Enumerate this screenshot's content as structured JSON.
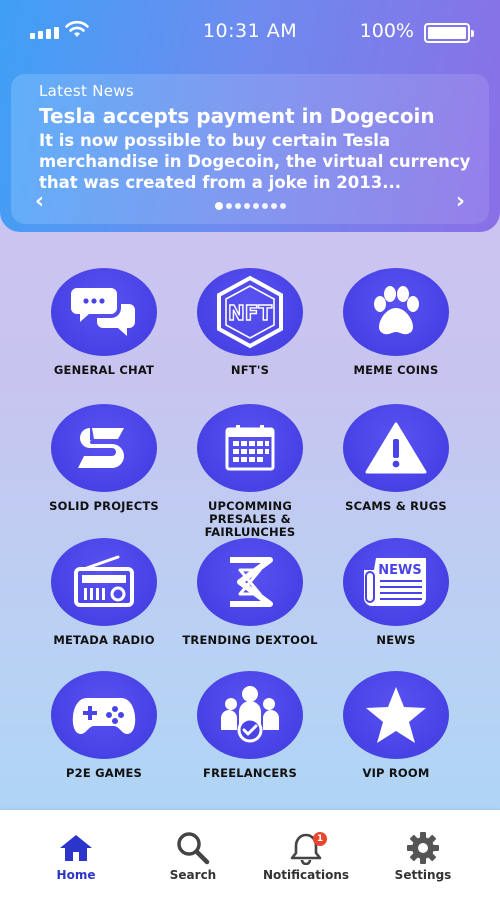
{
  "status_bar": {
    "time": "10:31 AM",
    "battery_percent": "100%",
    "battery_level": 1.0,
    "signal_icon": "signal-bars-icon",
    "wifi_icon": "wifi-icon"
  },
  "news": {
    "label": "Latest News",
    "title": "Tesla accepts payment in Dogecoin",
    "body": "It is now possible to buy certain Tesla merchandise in Dogecoin, the virtual currency that was created from a joke in 2013...",
    "prev_icon": "chevron-left-icon",
    "next_icon": "chevron-right-icon",
    "page_count": 8,
    "active_page": 1
  },
  "tiles": [
    {
      "label": "GENERAL CHAT",
      "icon": "chat-bubbles-icon"
    },
    {
      "label": "NFT'S",
      "icon": "nft-hexagon-icon"
    },
    {
      "label": "MEME COINS",
      "icon": "paw-icon"
    },
    {
      "label": "SOLID PROJECTS",
      "icon": "s-logo-icon"
    },
    {
      "label": "UPCOMMING PRESALES & FAIRLUNCHES",
      "icon": "calendar-icon"
    },
    {
      "label": "SCAMS & RUGS",
      "icon": "warning-icon"
    },
    {
      "label": "METADA RADIO",
      "icon": "radio-icon"
    },
    {
      "label": "TRENDING DEXTOOL",
      "icon": "dextool-icon"
    },
    {
      "label": "NEWS",
      "icon": "newspaper-icon"
    },
    {
      "label": "P2E GAMES",
      "icon": "gamepad-icon"
    },
    {
      "label": "FREELANCERS",
      "icon": "freelancers-icon"
    },
    {
      "label": "VIP ROOM",
      "icon": "star-icon"
    }
  ],
  "tabbar": {
    "tabs": [
      {
        "label": "Home",
        "icon": "home-icon",
        "active": true
      },
      {
        "label": "Search",
        "icon": "search-icon",
        "active": false
      },
      {
        "label": "Notifications",
        "icon": "bell-icon",
        "active": false,
        "badge": "1"
      },
      {
        "label": "Settings",
        "icon": "gear-icon",
        "active": false
      }
    ]
  },
  "colors": {
    "accent": "#4a44e8",
    "active_tab": "#2b35c9",
    "badge": "#e8452c"
  }
}
